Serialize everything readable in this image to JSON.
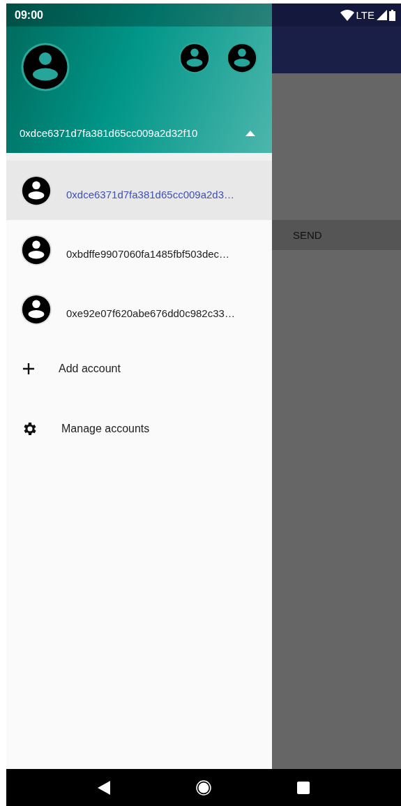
{
  "status_bar": {
    "time": "09:00",
    "network": "LTE"
  },
  "drawer_header": {
    "current_account": "0xdce6371d7fa381d65cc009a2d32f10",
    "expanded": true
  },
  "accounts": [
    {
      "address": "0xdce6371d7fa381d65cc009a2d3…",
      "selected": true
    },
    {
      "address": "0xbdffe9907060fa1485fbf503dec…",
      "selected": false
    },
    {
      "address": "0xe92e07f620abe676dd0c982c33…",
      "selected": false
    }
  ],
  "actions": [
    {
      "kind": "add",
      "label": "Add account"
    },
    {
      "kind": "manage",
      "label": "Manage accounts"
    }
  ],
  "background": {
    "button": "SEND"
  }
}
